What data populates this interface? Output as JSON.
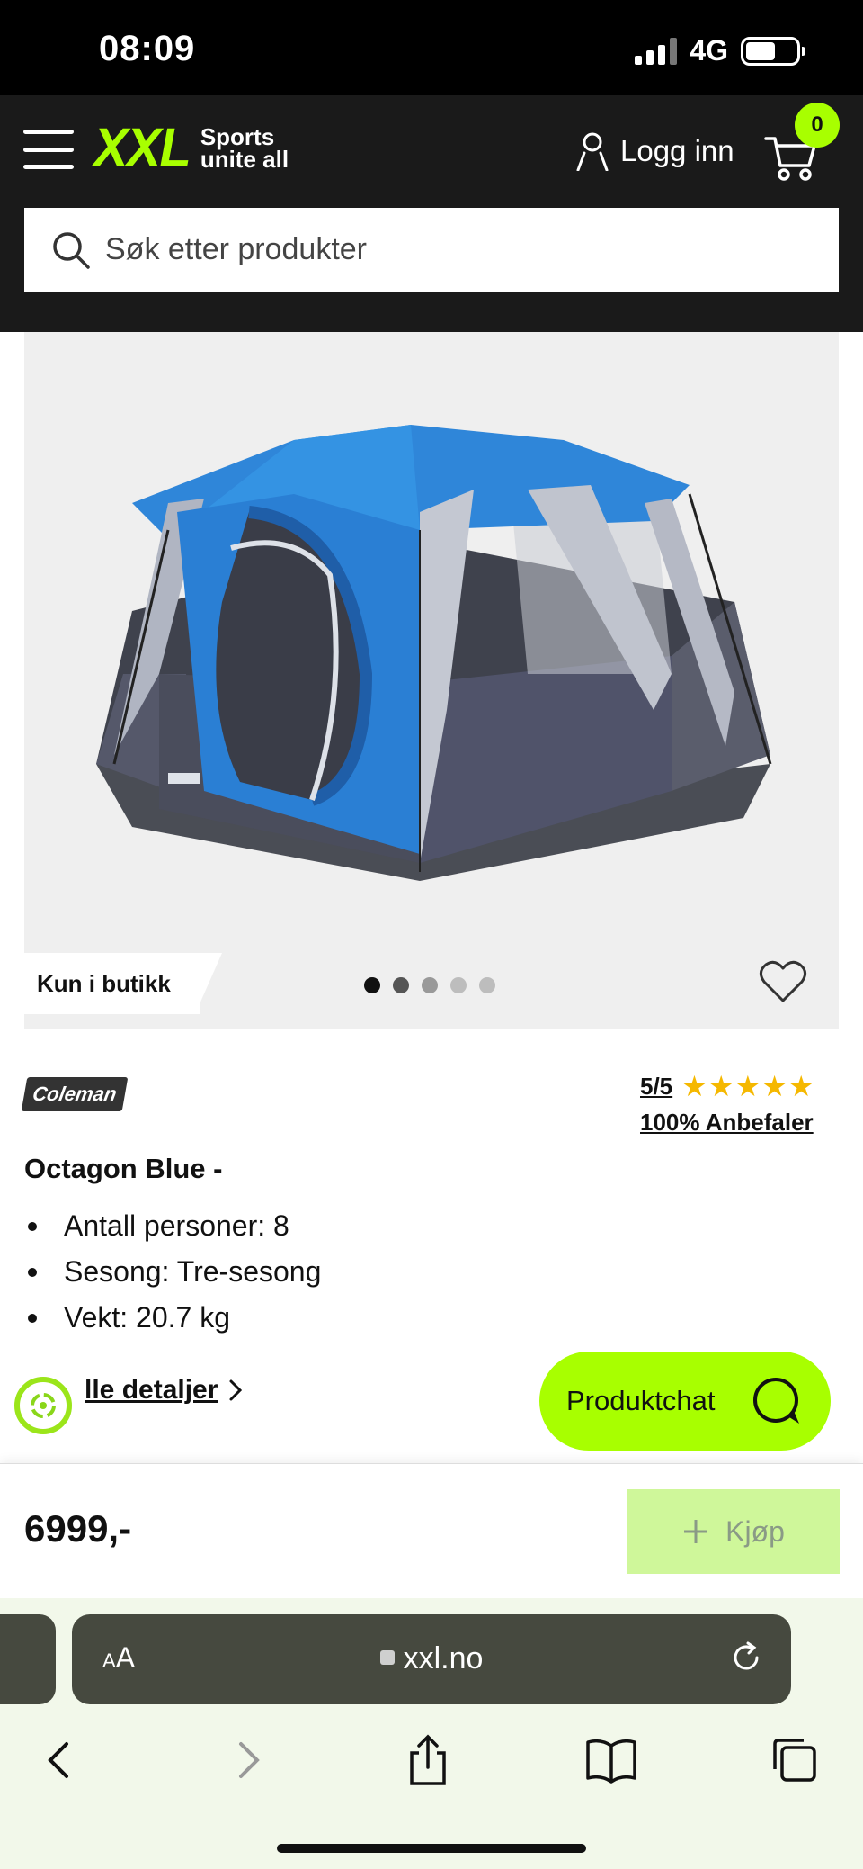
{
  "status_bar": {
    "time": "08:09",
    "network": "4G"
  },
  "header": {
    "logo_mark": "XXL",
    "logo_tagline_1": "Sports",
    "logo_tagline_2": "unite all",
    "login_label": "Logg inn",
    "cart_count": "0"
  },
  "search": {
    "placeholder": "Søk etter produkter"
  },
  "media": {
    "badge": "Kun i butikk",
    "image_count": 5,
    "active_index": 0
  },
  "product": {
    "brand": "Coleman",
    "rating_score": "5/5",
    "stars": "★★★★★",
    "recommend": "100% Anbefaler",
    "title": "Octagon Blue -",
    "features": [
      "Antall personer: 8",
      "Sesong: Tre-sesong",
      "Vekt: 20.7 kg"
    ],
    "details_link": "lle detaljer"
  },
  "chat": {
    "label": "Produktchat"
  },
  "buy_bar": {
    "price": "6999,-",
    "buy_label": "Kjøp"
  },
  "browser": {
    "text_size": "AA",
    "url": "xxl.no"
  },
  "colors": {
    "accent": "#a8ff00",
    "header_bg": "#1a1a1a",
    "star": "#f5b800"
  }
}
